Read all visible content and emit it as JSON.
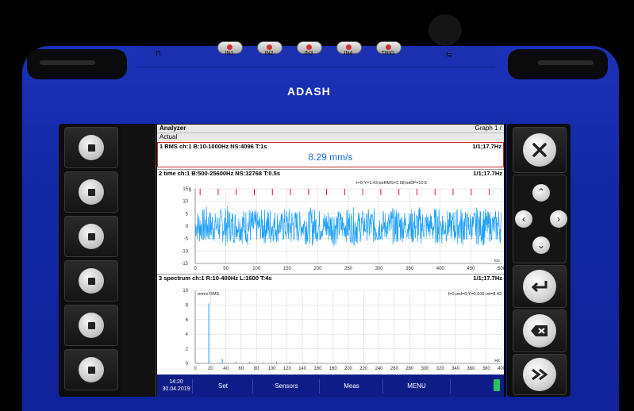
{
  "device": {
    "brand": "ADASH",
    "ports": [
      "IN1",
      "IN2",
      "IN3",
      "IN4",
      "TRIG"
    ],
    "colors": {
      "body": "#1228a4",
      "accent_red": "#c62828",
      "signal_blue": "#1ea0ff"
    }
  },
  "app": {
    "title": "Analyzer",
    "graph_label": "Graph 1 /",
    "subtitle": "Actual",
    "panels": {
      "rms": {
        "header": "1 RMS ch:1 B:10-1000Hz NS:4096 T:1s",
        "page": "1/1;17.7Hz",
        "value": "8.29 mm/s"
      },
      "time": {
        "header": "2 time ch:1 B:500-25600Hz NS:32768 T:0.5s",
        "page": "1/1;17.7Hz",
        "readout": "t=0;Y=1.43;totRMS=2.68;tot0P=10.5",
        "y_unit": "g",
        "x_unit": "ms",
        "y_ticks": [
          "15",
          "10",
          "5",
          "0",
          "-5",
          "-10",
          "-15"
        ],
        "x_ticks": [
          "0",
          "50",
          "100",
          "150",
          "200",
          "250",
          "300",
          "350",
          "400",
          "450",
          "500"
        ]
      },
      "spectrum": {
        "header": "3 spectrum ch:1 R:10-400Hz L:1600 T:4s",
        "page": "1/1;17.7Hz",
        "readout": "f=0;ord=0;Y=0.000;tot=8.42",
        "y_unit": "mm/s RMS",
        "x_unit": "Hz",
        "y_ticks": [
          "10",
          "8",
          "6",
          "4",
          "2",
          "0"
        ],
        "x_ticks": [
          "0",
          "20",
          "40",
          "60",
          "80",
          "100",
          "120",
          "140",
          "160",
          "180",
          "200",
          "220",
          "240",
          "260",
          "280",
          "300",
          "320",
          "340",
          "360",
          "380",
          "400"
        ]
      }
    },
    "status": {
      "time": "14:20",
      "date": "30.04.2019"
    },
    "softkeys": [
      "Set",
      "Sensors",
      "Meas",
      "MENU"
    ]
  },
  "chart_data": [
    {
      "type": "line",
      "title": "2 time ch:1 B:500-25600Hz NS:32768 T:0.5s",
      "xlabel": "ms",
      "ylabel": "g",
      "xlim": [
        0,
        500
      ],
      "ylim": [
        -15,
        15
      ],
      "grid": true,
      "series": [
        {
          "values": []
        }
      ]
    },
    {
      "type": "bar",
      "title": "3 spectrum ch:1 R:10-400Hz L:1600 T:4s",
      "xlabel": "Hz",
      "ylabel": "mm/s RMS",
      "xlim": [
        0,
        400
      ],
      "ylim": [
        0,
        10
      ],
      "grid": true,
      "x": [
        17.7,
        35.4,
        53.1,
        70.8,
        88.5,
        106.2,
        123.9,
        141.6,
        159.3
      ],
      "values": [
        8.2,
        0.6,
        0.25,
        0.2,
        0.15,
        0.2,
        0.15,
        0.1,
        0.1
      ]
    }
  ]
}
